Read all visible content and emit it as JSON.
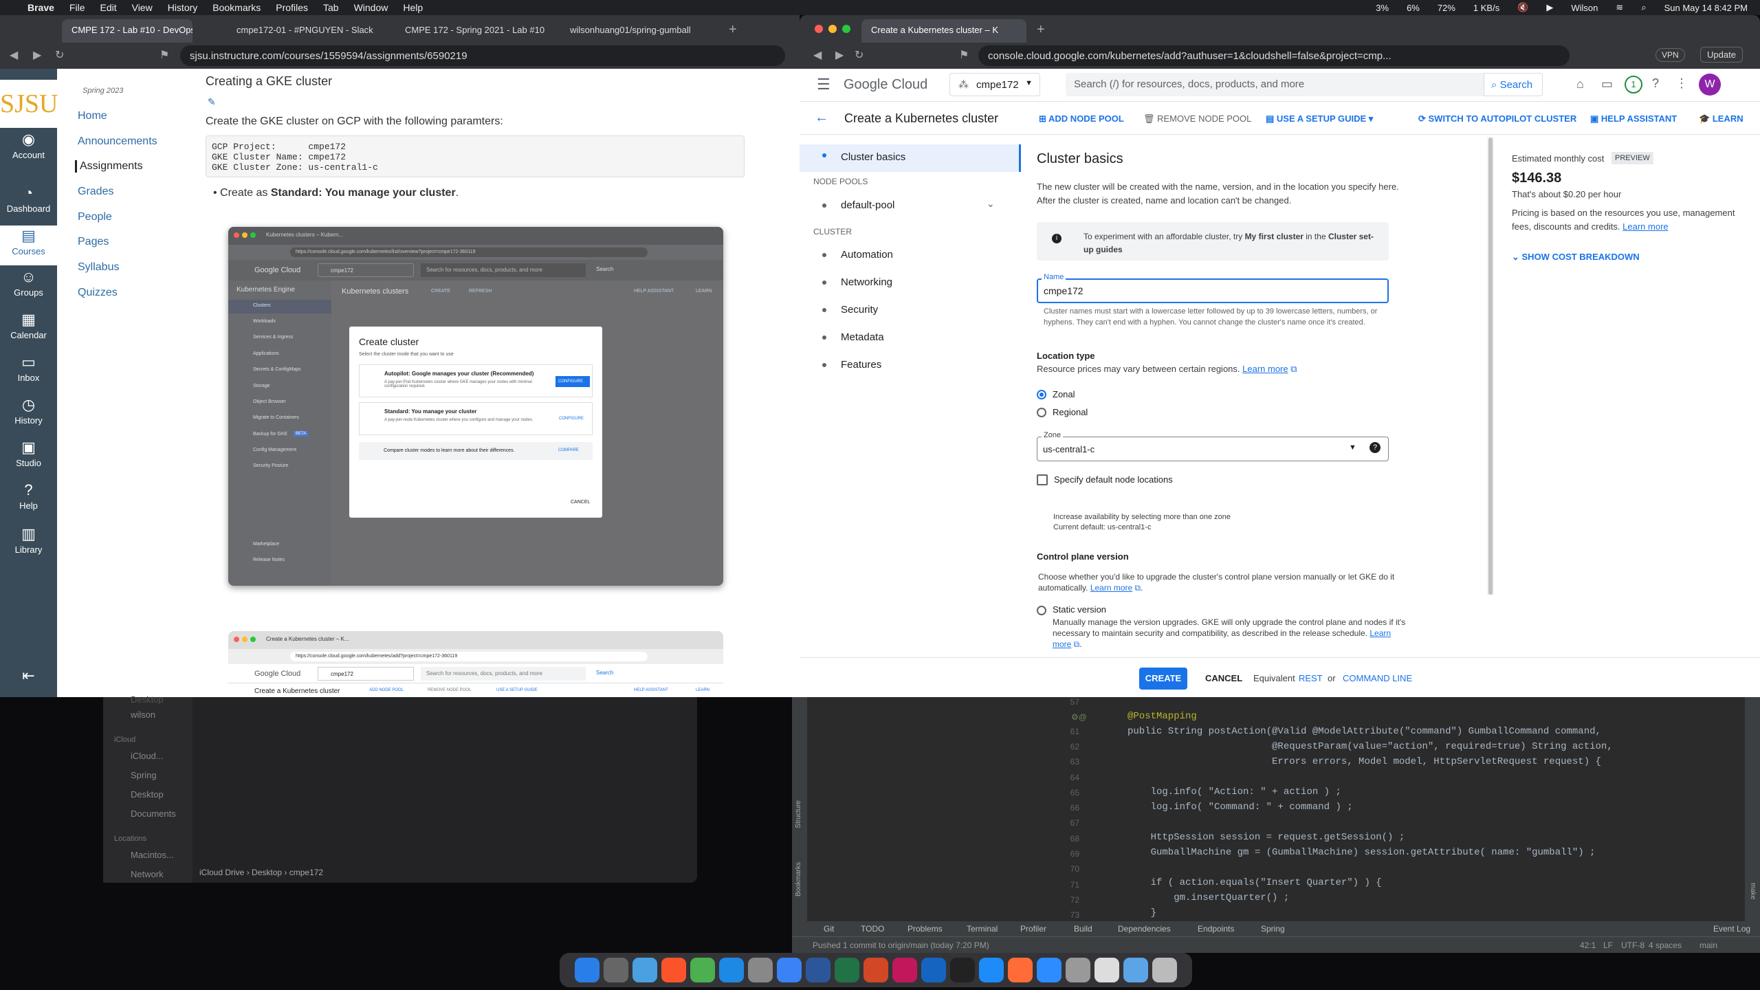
{
  "menubar": {
    "app": "Brave",
    "items": [
      "File",
      "Edit",
      "View",
      "History",
      "Bookmarks",
      "Profiles",
      "Tab",
      "Window",
      "Help"
    ],
    "status": {
      "cpu": "3%",
      "gpu": "6%",
      "ram": "72%",
      "net": "1 KB/s",
      "user": "Wilson",
      "vpn_icon": "globe",
      "datetime": "Sun May 14  8:42 PM"
    }
  },
  "left_browser": {
    "tabs": [
      "CMPE 172 - Lab #10 - DevOps (",
      "cmpe172-01 - #PNGUYEN - Slack",
      "CMPE 172 - Spring 2021 - Lab #10",
      "wilsonhuang01/spring-gumball"
    ],
    "url": "sjsu.instructure.com/courses/1559594/assignments/6590219",
    "canvas_nav": [
      {
        "label": "Account",
        "icon": "avatar"
      },
      {
        "label": "Dashboard",
        "icon": "dashboard-icon"
      },
      {
        "label": "Courses",
        "icon": "book-icon"
      },
      {
        "label": "Groups",
        "icon": "groups-icon"
      },
      {
        "label": "Calendar",
        "icon": "calendar-icon"
      },
      {
        "label": "Inbox",
        "icon": "inbox-icon"
      },
      {
        "label": "History",
        "icon": "clock-icon"
      },
      {
        "label": "Studio",
        "icon": "studio-icon"
      },
      {
        "label": "Help",
        "icon": "help-icon"
      },
      {
        "label": "Library",
        "icon": "library-icon"
      }
    ],
    "logo": "SJSU",
    "term": "Spring 2023",
    "course_nav": [
      "Home",
      "Announcements",
      "Assignments",
      "Grades",
      "People",
      "Pages",
      "Syllabus",
      "Quizzes"
    ],
    "heading": "Creating a GKE cluster",
    "intro": "Create the GKE cluster on GCP with the following paramters:",
    "code": "GCP Project:      cmpe172\nGKE Cluster Name: cmpe172\nGKE Cluster Zone: us-central1-c",
    "bullet_prefix": "Create as ",
    "bullet_bold": "Standard: You manage your cluster",
    "bullet_suffix": ".",
    "shot1": {
      "tab": "Kubernetes clusters – Kubern...",
      "url": "https://console.cloud.google.com/kubernetes/list/overview?project=cmpe172-360119",
      "brand": "Google Cloud",
      "project": "cmpe172",
      "search": "Search for resources, docs, products, and more",
      "search_btn": "Search",
      "product": "Kubernetes Engine",
      "page": "Kubernetes clusters",
      "create": "CREATE",
      "refresh": "REFRESH",
      "help": "HELP ASSISTANT",
      "learn": "LEARN",
      "nav": [
        "Clusters",
        "Workloads",
        "Services & Ingress",
        "Applications",
        "Secrets & ConfigMaps",
        "Storage",
        "Object Browser",
        "Migrate to Containers",
        "Backup for GKE",
        "Config Management",
        "Security Posture"
      ],
      "nav_bottom": [
        "Marketplace",
        "Release Notes"
      ],
      "beta": "BETA",
      "dialog": {
        "title": "Create cluster",
        "sub": "Select the cluster mode that you want to use",
        "opt1_title": "Autopilot: Google manages your cluster (Recommended)",
        "opt1_desc": "A pay-per-Pod Kubernetes cluster where GKE manages your nodes with minimal configuration required.",
        "opt1_more": "Learn more",
        "opt1_btn": "CONFIGURE",
        "opt2_title": "Standard: You manage your cluster",
        "opt2_desc": "A pay-per-node Kubernetes cluster where you configure and manage your nodes.",
        "opt2_more": "Learn more",
        "opt2_btn": "CONFIGURE",
        "compare": "Compare cluster modes to learn more about their differences.",
        "compare_btn": "COMPARE",
        "cancel": "CANCEL"
      }
    },
    "shot2": {
      "tab": "Create a Kubernetes cluster – K...",
      "url": "https://console.cloud.google.com/kubernetes/add?project=cmpe172-360119",
      "brand": "Google Cloud",
      "project": "cmpe172",
      "search": "Search for resources, docs, products, and more",
      "search_btn": "Search",
      "page": "Create a Kubernetes cluster",
      "add": "ADD NODE POOL",
      "remove": "REMOVE NODE POOL",
      "guide": "USE A SETUP GUIDE",
      "help": "HELP ASSISTANT",
      "learn": "LEARN"
    }
  },
  "finder": {
    "items": [
      "Desktop",
      "wilson"
    ],
    "icloud_header": "iCloud",
    "icloud": [
      "iCloud...",
      "Spring",
      "Desktop",
      "Documents"
    ],
    "locations_header": "Locations",
    "locations": [
      "Macintos...",
      "Network"
    ],
    "path": [
      "iCloud Drive",
      "Desktop",
      "cmpe172"
    ],
    "top_partial": "Desktop"
  },
  "gke": {
    "tab": "Create a Kubernetes cluster – K",
    "url": "console.cloud.google.com/kubernetes/add?authuser=1&cloudshell=false&project=cmp...",
    "vpn": "VPN",
    "update": "Update",
    "brand": "Google Cloud",
    "project": "cmpe172",
    "search_placeholder": "Search (/) for resources, docs, products, and more",
    "search_btn": "Search",
    "notif": "1",
    "avatar": "W",
    "title": "Create a Kubernetes cluster",
    "actions": {
      "add": "ADD NODE POOL",
      "remove": "REMOVE NODE POOL",
      "guide": "USE A SETUP GUIDE",
      "autopilot": "SWITCH TO AUTOPILOT CLUSTER",
      "help": "HELP ASSISTANT",
      "learn": "LEARN"
    },
    "nav": {
      "basics": "Cluster basics",
      "node_pools_header": "NODE POOLS",
      "default_pool": "default-pool",
      "cluster_header": "CLUSTER",
      "items": [
        "Automation",
        "Networking",
        "Security",
        "Metadata",
        "Features"
      ]
    },
    "form": {
      "heading": "Cluster basics",
      "desc": "The new cluster will be created with the name, version, and in the location you specify here. After the cluster is created, name and location can't be changed.",
      "info_pre": "To experiment with an affordable cluster, try ",
      "info_bold1": "My first cluster",
      "info_mid": " in the ",
      "info_bold2": "Cluster set-up guides",
      "name_label": "Name",
      "name_value": "cmpe172",
      "name_help": "Cluster names must start with a lowercase letter followed by up to 39 lowercase letters, numbers, or hyphens. They can't end with a hyphen. You cannot change the cluster's name once it's created.",
      "loc_title": "Location type",
      "loc_desc": "Resource prices may vary between certain regions. ",
      "learn_more": "Learn more",
      "zonal": "Zonal",
      "regional": "Regional",
      "zone_label": "Zone",
      "zone_value": "us-central1-c",
      "specify": "Specify default node locations",
      "avail1": "Increase availability by selecting more than one zone",
      "avail2": "Current default: us-central1-c",
      "cp_title": "Control plane version",
      "cp_desc": "Choose whether you'd like to upgrade the cluster's control plane version manually or let GKE do it automatically. ",
      "static_title": "Static version",
      "static_desc": "Manually manage the version upgrades. GKE will only upgrade the control plane and nodes if it's necessary to maintain security and compatibility, as described in the release schedule. "
    },
    "cost": {
      "label": "Estimated monthly cost",
      "badge": "PREVIEW",
      "amount": "$146.38",
      "hourly": "That's about $0.20 per hour",
      "desc": "Pricing is based on the resources you use, management fees, discounts and credits. ",
      "learn": "Learn more",
      "breakdown": "SHOW COST BREAKDOWN"
    },
    "footer": {
      "create": "CREATE",
      "cancel": "CANCEL",
      "equivalent": "Equivalent",
      "rest": "REST",
      "or": "or",
      "cli": "COMMAND LINE"
    }
  },
  "ide": {
    "line_numbers": [
      "57",
      "61",
      "62",
      "63",
      "64",
      "65",
      "66",
      "67",
      "68",
      "69",
      "70",
      "71",
      "72",
      "73"
    ],
    "lines": [
      "@PostMapping",
      "public String postAction(@Valid @ModelAttribute(\"command\") GumballCommand command,",
      "                         @RequestParam(value=\"action\", required=true) String action,",
      "                         Errors errors, Model model, HttpServletRequest request) {",
      "",
      "    log.info( \"Action: \" + action ) ;",
      "    log.info( \"Command: \" + command ) ;",
      "",
      "    HttpSession session = request.getSession() ;",
      "    GumballMachine gm = (GumballMachine) session.getAttribute( name: \"gumball\") ;",
      "",
      "    if ( action.equals(\"Insert Quarter\") ) {",
      "        gm.insertQuarter() ;",
      "    }"
    ],
    "side_labels": [
      "Structure",
      "Bookmarks"
    ],
    "right_side": "make",
    "tool_tabs": [
      "Git",
      "TODO",
      "Problems",
      "Terminal",
      "Profiler",
      "Build",
      "Dependencies",
      "Endpoints",
      "Spring"
    ],
    "event_log": "Event Log",
    "status_msg": "Pushed 1 commit to origin/main (today 7:20 PM)",
    "status_right": [
      "42:1",
      "LF",
      "UTF-8",
      "4 spaces",
      "main"
    ]
  }
}
